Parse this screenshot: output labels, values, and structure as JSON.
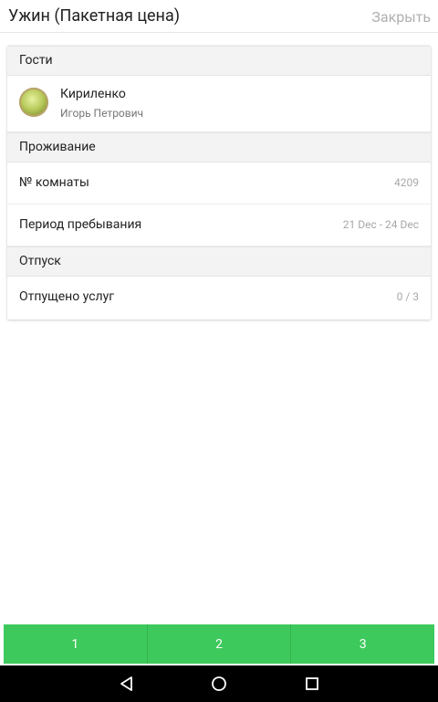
{
  "header": {
    "title": "Ужин (Пакетная цена)",
    "close_label": "Закрыть"
  },
  "sections": {
    "guests": {
      "label": "Гости"
    },
    "stay": {
      "label": "Проживание"
    },
    "release": {
      "label": "Отпуск"
    }
  },
  "guest": {
    "last_name": "Кириленко",
    "first_name": "Игорь Петрович"
  },
  "stay_rows": {
    "room": {
      "label": "№ комнаты",
      "value": "4209"
    },
    "period": {
      "label": "Период пребывания",
      "value": "21 Dec - 24 Dec"
    }
  },
  "release_rows": {
    "services": {
      "label": "Отпущено услуг",
      "value": "0 / 3"
    }
  },
  "bottom_buttons": [
    "1",
    "2",
    "3"
  ],
  "colors": {
    "accent": "#3ec95c",
    "navbar": "#000000"
  },
  "navigation": {
    "icons": [
      "back-icon",
      "home-icon",
      "recents-icon"
    ]
  }
}
